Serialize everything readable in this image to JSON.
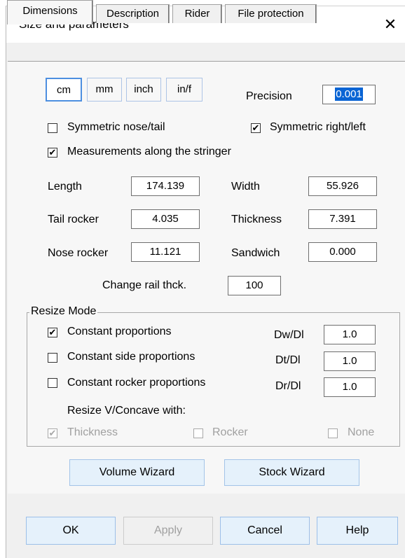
{
  "window": {
    "title": "Size and parameters",
    "close_glyph": "✕"
  },
  "tabs": [
    {
      "label": "Dimensions",
      "active": true
    },
    {
      "label": "Description",
      "active": false
    },
    {
      "label": "Rider",
      "active": false
    },
    {
      "label": "File protection",
      "active": false
    }
  ],
  "units": [
    {
      "label": "cm",
      "selected": true
    },
    {
      "label": "mm",
      "selected": false
    },
    {
      "label": "inch",
      "selected": false
    },
    {
      "label": "in/f",
      "selected": false
    }
  ],
  "precision": {
    "label": "Precision",
    "value": "0.001"
  },
  "options": {
    "symmetric_nose_tail": {
      "label": "Symmetric nose/tail",
      "checked": false
    },
    "symmetric_right_left": {
      "label": "Symmetric right/left",
      "checked": true
    },
    "measure_along_stringer": {
      "label": "Measurements along the stringer",
      "checked": true
    }
  },
  "dimensions": {
    "length": {
      "label": "Length",
      "value": "174.139"
    },
    "width": {
      "label": "Width",
      "value": "55.926"
    },
    "tail_rocker": {
      "label": "Tail rocker",
      "value": "4.035"
    },
    "thickness": {
      "label": "Thickness",
      "value": "7.391"
    },
    "nose_rocker": {
      "label": "Nose rocker",
      "value": "11.121"
    },
    "sandwich": {
      "label": "Sandwich",
      "value": "0.000"
    },
    "change_rail": {
      "label": "Change rail thck.",
      "value": "100"
    }
  },
  "resize": {
    "title": "Resize Mode",
    "constant_proportions": {
      "label": "Constant proportions",
      "checked": true,
      "ratio_label": "Dw/Dl",
      "ratio_value": "1.0"
    },
    "constant_side": {
      "label": "Constant side proportions",
      "checked": false,
      "ratio_label": "Dt/Dl",
      "ratio_value": "1.0"
    },
    "constant_rocker": {
      "label": "Constant rocker proportions",
      "checked": false,
      "ratio_label": "Dr/Dl",
      "ratio_value": "1.0"
    },
    "concave_label": "Resize V/Concave with:",
    "thickness": {
      "label": "Thickness",
      "checked": true
    },
    "rocker": {
      "label": "Rocker",
      "checked": false
    },
    "none": {
      "label": "None",
      "checked": false
    }
  },
  "wizards": {
    "volume": "Volume Wizard",
    "stock": "Stock Wizard"
  },
  "buttons": {
    "ok": "OK",
    "apply": "Apply",
    "cancel": "Cancel",
    "help": "Help"
  },
  "check_glyph": "✔"
}
